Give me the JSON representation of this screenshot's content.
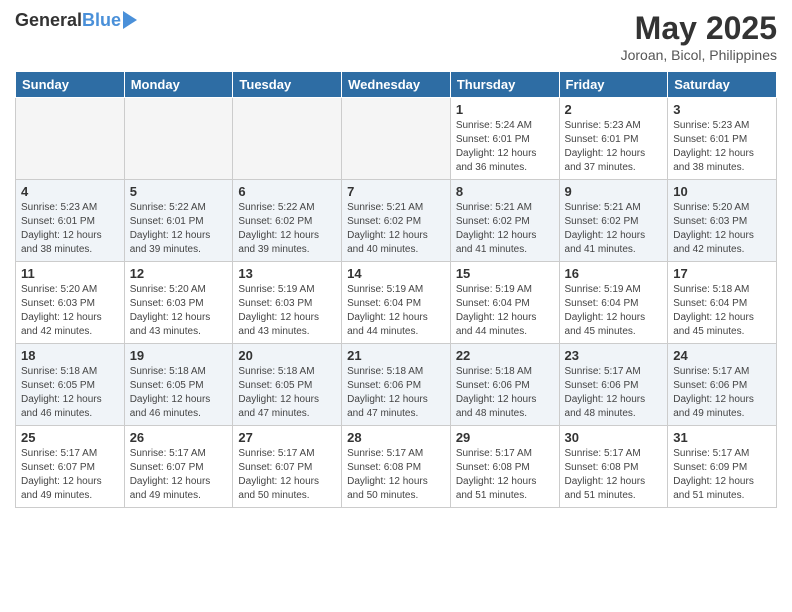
{
  "header": {
    "logo_general": "General",
    "logo_blue": "Blue",
    "title": "May 2025",
    "location": "Joroan, Bicol, Philippines"
  },
  "days_of_week": [
    "Sunday",
    "Monday",
    "Tuesday",
    "Wednesday",
    "Thursday",
    "Friday",
    "Saturday"
  ],
  "weeks": [
    [
      {
        "day": "",
        "info": ""
      },
      {
        "day": "",
        "info": ""
      },
      {
        "day": "",
        "info": ""
      },
      {
        "day": "",
        "info": ""
      },
      {
        "day": "1",
        "info": "Sunrise: 5:24 AM\nSunset: 6:01 PM\nDaylight: 12 hours\nand 36 minutes."
      },
      {
        "day": "2",
        "info": "Sunrise: 5:23 AM\nSunset: 6:01 PM\nDaylight: 12 hours\nand 37 minutes."
      },
      {
        "day": "3",
        "info": "Sunrise: 5:23 AM\nSunset: 6:01 PM\nDaylight: 12 hours\nand 38 minutes."
      }
    ],
    [
      {
        "day": "4",
        "info": "Sunrise: 5:23 AM\nSunset: 6:01 PM\nDaylight: 12 hours\nand 38 minutes."
      },
      {
        "day": "5",
        "info": "Sunrise: 5:22 AM\nSunset: 6:01 PM\nDaylight: 12 hours\nand 39 minutes."
      },
      {
        "day": "6",
        "info": "Sunrise: 5:22 AM\nSunset: 6:02 PM\nDaylight: 12 hours\nand 39 minutes."
      },
      {
        "day": "7",
        "info": "Sunrise: 5:21 AM\nSunset: 6:02 PM\nDaylight: 12 hours\nand 40 minutes."
      },
      {
        "day": "8",
        "info": "Sunrise: 5:21 AM\nSunset: 6:02 PM\nDaylight: 12 hours\nand 41 minutes."
      },
      {
        "day": "9",
        "info": "Sunrise: 5:21 AM\nSunset: 6:02 PM\nDaylight: 12 hours\nand 41 minutes."
      },
      {
        "day": "10",
        "info": "Sunrise: 5:20 AM\nSunset: 6:03 PM\nDaylight: 12 hours\nand 42 minutes."
      }
    ],
    [
      {
        "day": "11",
        "info": "Sunrise: 5:20 AM\nSunset: 6:03 PM\nDaylight: 12 hours\nand 42 minutes."
      },
      {
        "day": "12",
        "info": "Sunrise: 5:20 AM\nSunset: 6:03 PM\nDaylight: 12 hours\nand 43 minutes."
      },
      {
        "day": "13",
        "info": "Sunrise: 5:19 AM\nSunset: 6:03 PM\nDaylight: 12 hours\nand 43 minutes."
      },
      {
        "day": "14",
        "info": "Sunrise: 5:19 AM\nSunset: 6:04 PM\nDaylight: 12 hours\nand 44 minutes."
      },
      {
        "day": "15",
        "info": "Sunrise: 5:19 AM\nSunset: 6:04 PM\nDaylight: 12 hours\nand 44 minutes."
      },
      {
        "day": "16",
        "info": "Sunrise: 5:19 AM\nSunset: 6:04 PM\nDaylight: 12 hours\nand 45 minutes."
      },
      {
        "day": "17",
        "info": "Sunrise: 5:18 AM\nSunset: 6:04 PM\nDaylight: 12 hours\nand 45 minutes."
      }
    ],
    [
      {
        "day": "18",
        "info": "Sunrise: 5:18 AM\nSunset: 6:05 PM\nDaylight: 12 hours\nand 46 minutes."
      },
      {
        "day": "19",
        "info": "Sunrise: 5:18 AM\nSunset: 6:05 PM\nDaylight: 12 hours\nand 46 minutes."
      },
      {
        "day": "20",
        "info": "Sunrise: 5:18 AM\nSunset: 6:05 PM\nDaylight: 12 hours\nand 47 minutes."
      },
      {
        "day": "21",
        "info": "Sunrise: 5:18 AM\nSunset: 6:06 PM\nDaylight: 12 hours\nand 47 minutes."
      },
      {
        "day": "22",
        "info": "Sunrise: 5:18 AM\nSunset: 6:06 PM\nDaylight: 12 hours\nand 48 minutes."
      },
      {
        "day": "23",
        "info": "Sunrise: 5:17 AM\nSunset: 6:06 PM\nDaylight: 12 hours\nand 48 minutes."
      },
      {
        "day": "24",
        "info": "Sunrise: 5:17 AM\nSunset: 6:06 PM\nDaylight: 12 hours\nand 49 minutes."
      }
    ],
    [
      {
        "day": "25",
        "info": "Sunrise: 5:17 AM\nSunset: 6:07 PM\nDaylight: 12 hours\nand 49 minutes."
      },
      {
        "day": "26",
        "info": "Sunrise: 5:17 AM\nSunset: 6:07 PM\nDaylight: 12 hours\nand 49 minutes."
      },
      {
        "day": "27",
        "info": "Sunrise: 5:17 AM\nSunset: 6:07 PM\nDaylight: 12 hours\nand 50 minutes."
      },
      {
        "day": "28",
        "info": "Sunrise: 5:17 AM\nSunset: 6:08 PM\nDaylight: 12 hours\nand 50 minutes."
      },
      {
        "day": "29",
        "info": "Sunrise: 5:17 AM\nSunset: 6:08 PM\nDaylight: 12 hours\nand 51 minutes."
      },
      {
        "day": "30",
        "info": "Sunrise: 5:17 AM\nSunset: 6:08 PM\nDaylight: 12 hours\nand 51 minutes."
      },
      {
        "day": "31",
        "info": "Sunrise: 5:17 AM\nSunset: 6:09 PM\nDaylight: 12 hours\nand 51 minutes."
      }
    ]
  ]
}
